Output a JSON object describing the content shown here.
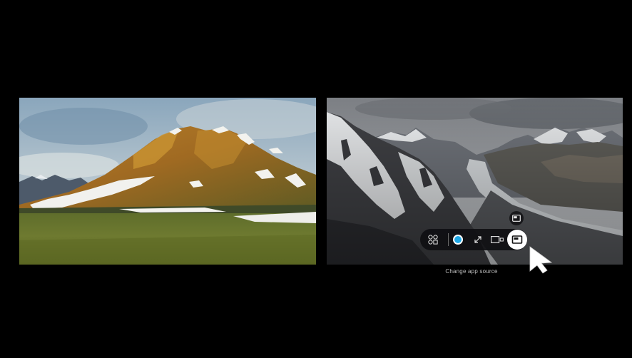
{
  "screen": {
    "background": "#000000"
  },
  "left_panel": {
    "content": "mountain-landscape-video"
  },
  "right_panel": {
    "content": "glacier-valley-video"
  },
  "toolbar": {
    "buttons": [
      {
        "icon": "app-grid-icon"
      },
      {
        "icon": "focus-circle-icon"
      },
      {
        "icon": "expand-icon"
      },
      {
        "icon": "split-screen-icon"
      },
      {
        "icon": "change-app-source-icon",
        "selected": true
      }
    ],
    "extra_button": {
      "icon": "picture-in-picture-icon"
    },
    "caption": "Change app source",
    "accent_color": "#1fa8e6"
  }
}
